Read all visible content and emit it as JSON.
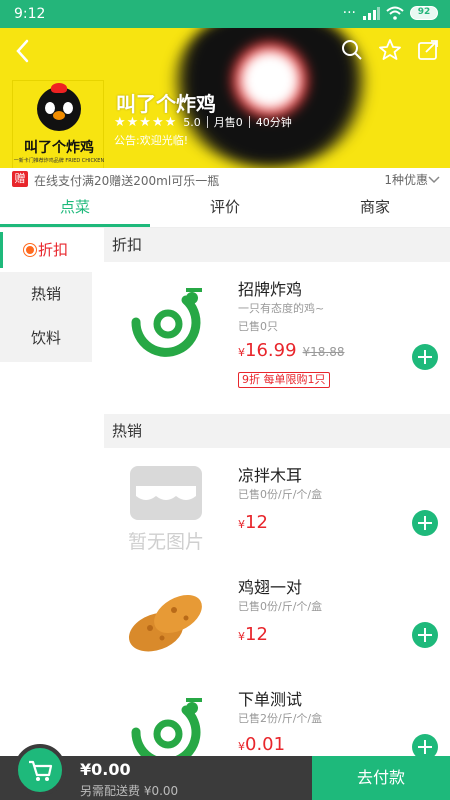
{
  "status_bar": {
    "time": "9:12",
    "battery": "92"
  },
  "shop": {
    "name": "叫了个炸鸡",
    "rating": "5.0",
    "monthly_sales": "月售0",
    "delivery_time": "40分钟",
    "notice": "公告:欢迎光临!",
    "logo_text": "叫了个炸鸡",
    "logo_sub": "一新卡门推荐炸鸡品牌 FRIED CHICKEN"
  },
  "promo": {
    "tag": "赠",
    "text": "在线支付满20赠送200ml可乐一瓶",
    "more": "1种优惠"
  },
  "tabs": [
    {
      "label": "点菜"
    },
    {
      "label": "评价"
    },
    {
      "label": "商家"
    }
  ],
  "categories": [
    {
      "label": "折扣"
    },
    {
      "label": "热销"
    },
    {
      "label": "饮料"
    }
  ],
  "sections": [
    {
      "title": "折扣"
    },
    {
      "title": "热销"
    }
  ],
  "items": [
    {
      "name": "招牌炸鸡",
      "desc": "一只有态度的鸡~",
      "sold": "已售0只",
      "currency": "¥",
      "price": "16.99",
      "orig_price": "¥18.88",
      "badge": "9折 每单限购1只",
      "image": "app-logo-icon"
    },
    {
      "name": "凉拌木耳",
      "sold": "已售0份/斤/个/盒",
      "currency": "¥",
      "price": "12",
      "image": "no-image-placeholder",
      "no_image_text": "暂无图片"
    },
    {
      "name": "鸡翅一对",
      "sold": "已售0份/斤/个/盒",
      "currency": "¥",
      "price": "12",
      "image": "fried-chicken-photo"
    },
    {
      "name": "下单测试",
      "sold": "已售2份/斤/个/盒",
      "currency": "¥",
      "price": "0.01",
      "image": "app-logo-icon"
    }
  ],
  "cart": {
    "total": "¥0.00",
    "fee": "另需配送费 ¥0.00",
    "pay_label": "去付款"
  },
  "colors": {
    "accent": "#1eb97b",
    "header_yellow": "#f7e411",
    "price_red": "#e8262c",
    "bottom_bar": "#3b3b3b"
  }
}
